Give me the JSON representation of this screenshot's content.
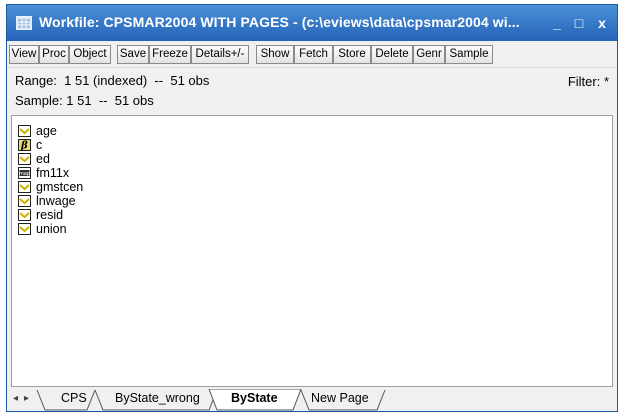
{
  "window": {
    "title": "Workfile: CPSMAR2004 WITH PAGES - (c:\\eviews\\data\\cpsmar2004 wi...",
    "minimize_symbol": "_",
    "maximize_symbol": "□",
    "close_symbol": "x"
  },
  "toolbar": {
    "buttons": [
      "View",
      "Proc",
      "Object",
      "Save",
      "Freeze",
      "Details+/-",
      "Show",
      "Fetch",
      "Store",
      "Delete",
      "Genr",
      "Sample"
    ]
  },
  "info": {
    "range": "Range:  1 51 (indexed)  --  51 obs",
    "sample": "Sample: 1 51  --  51 obs",
    "filter": "Filter: *"
  },
  "objects": [
    {
      "name": "age",
      "icon": "series-icon"
    },
    {
      "name": "c",
      "icon": "coefficient-icon"
    },
    {
      "name": "ed",
      "icon": "series-icon"
    },
    {
      "name": "fm11x",
      "icon": "map-icon"
    },
    {
      "name": "gmstcen",
      "icon": "series-icon"
    },
    {
      "name": "lnwage",
      "icon": "series-icon"
    },
    {
      "name": "resid",
      "icon": "series-icon"
    },
    {
      "name": "union",
      "icon": "series-icon"
    }
  ],
  "icon_labels": {
    "coefficient": "β",
    "map": "map"
  },
  "tabs": {
    "left_arrow": "◂",
    "right_arrow": "▸",
    "items": [
      "CPS",
      "ByState_wrong",
      "ByState",
      "New Page"
    ],
    "active": "ByState"
  },
  "colors": {
    "titlebar": "#2563b8",
    "series_icon": "#c8b400",
    "active_tab": "#ffffff"
  }
}
